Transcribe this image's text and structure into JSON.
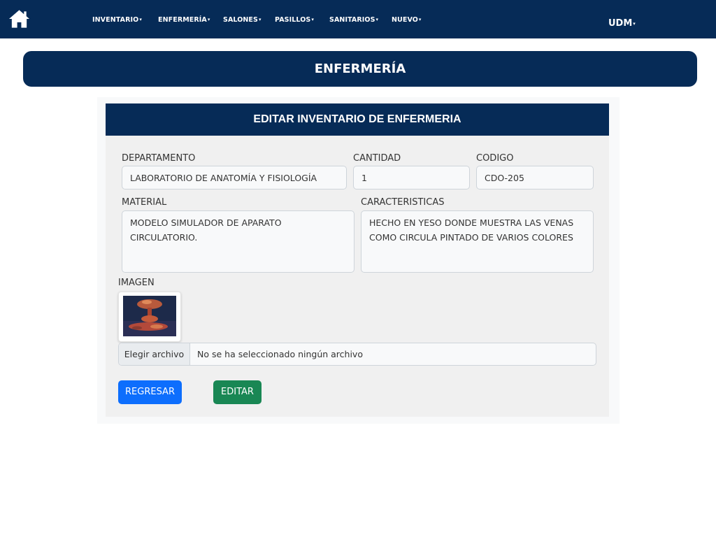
{
  "header": {
    "nav": [
      {
        "label": "INVENTARIO"
      },
      {
        "label": "ENFERMERÍA"
      },
      {
        "label": "SALONES"
      },
      {
        "label": "PASILLOS"
      },
      {
        "label": "SANITARIOS"
      },
      {
        "label": "NUEVO"
      }
    ],
    "user": "UDM",
    "caret": "▾"
  },
  "section_title": "ENFERMERÍA",
  "form": {
    "title": "EDITAR INVENTARIO DE ENFERMERIA",
    "departamento": {
      "label": "DEPARTAMENTO",
      "value": "LABORATORIO DE ANATOMÍA Y FISIOLOGÍA"
    },
    "cantidad": {
      "label": "CANTIDAD",
      "value": "1"
    },
    "codigo": {
      "label": "CODIGO",
      "value": "CDO-205"
    },
    "material": {
      "label": "MATERIAL",
      "value": "MODELO SIMULADOR DE APARATO CIRCULATORIO."
    },
    "caracteristicas": {
      "label": "CARACTERISTICAS",
      "value": "HECHO EN YESO DONDE MUESTRA LAS VENAS COMO CIRCULA PINTADO DE VARIOS COLORES"
    },
    "imagen": {
      "label": "IMAGEN"
    },
    "file": {
      "button_label": "Elegir archivo",
      "status": "No se ha seleccionado ningún archivo"
    },
    "buttons": {
      "back": "REGRESAR",
      "edit": "EDITAR"
    }
  },
  "colors": {
    "navy": "#062b57",
    "primary": "#0d6efd",
    "success": "#198754"
  },
  "icons": {
    "home": "home-icon"
  }
}
